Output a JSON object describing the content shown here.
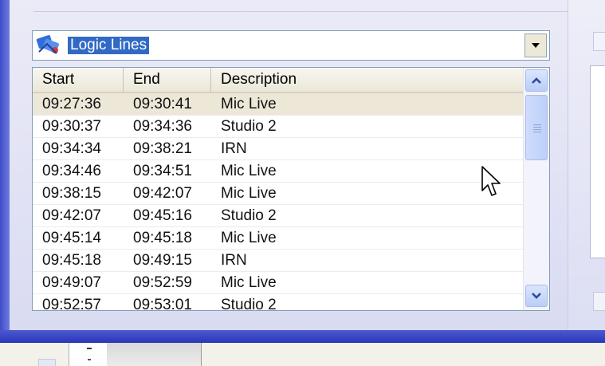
{
  "combo": {
    "selected": "Logic Lines",
    "icon": "logic-lines-icon"
  },
  "table": {
    "columns": [
      "Start",
      "End",
      "Description"
    ],
    "rows": [
      {
        "start": "09:27:36",
        "end": "09:30:41",
        "description": "Mic Live",
        "selected": true
      },
      {
        "start": "09:30:37",
        "end": "09:34:36",
        "description": "Studio 2"
      },
      {
        "start": "09:34:34",
        "end": "09:38:21",
        "description": "IRN"
      },
      {
        "start": "09:34:46",
        "end": "09:34:51",
        "description": "Mic Live"
      },
      {
        "start": "09:38:15",
        "end": "09:42:07",
        "description": "Mic Live"
      },
      {
        "start": "09:42:07",
        "end": "09:45:16",
        "description": "Studio 2"
      },
      {
        "start": "09:45:14",
        "end": "09:45:18",
        "description": "Mic Live"
      },
      {
        "start": "09:45:18",
        "end": "09:49:15",
        "description": "IRN"
      },
      {
        "start": "09:49:07",
        "end": "09:52:59",
        "description": "Mic Live"
      },
      {
        "start": "09:52:57",
        "end": "09:53:01",
        "description": "Studio 2"
      }
    ]
  },
  "colors": {
    "selection": "#316ac5",
    "selected_row": "#ece7d7",
    "frame": "#3e4cc8"
  }
}
